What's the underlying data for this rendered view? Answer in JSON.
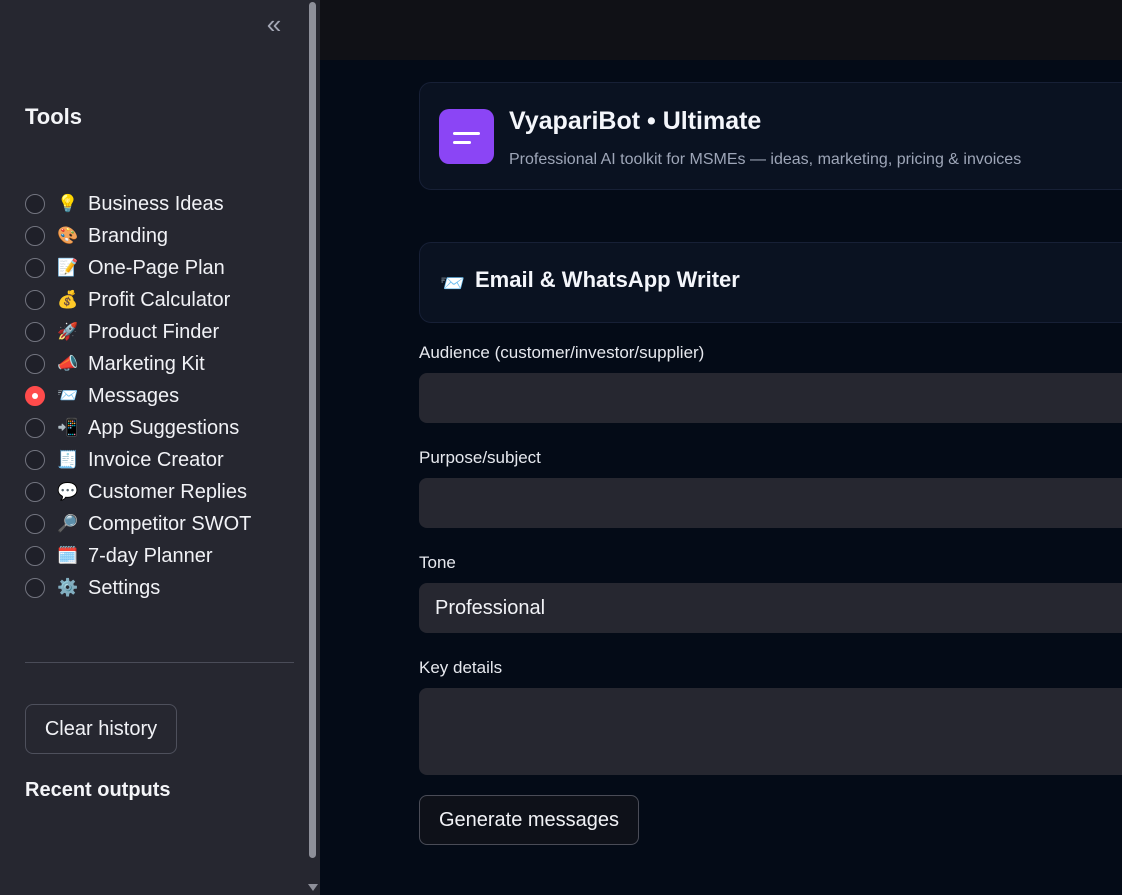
{
  "sidebar": {
    "title": "Tools",
    "items": [
      {
        "icon": "💡",
        "label": "Business Ideas",
        "selected": false
      },
      {
        "icon": "🎨",
        "label": "Branding",
        "selected": false
      },
      {
        "icon": "📝",
        "label": "One-Page Plan",
        "selected": false
      },
      {
        "icon": "💰",
        "label": "Profit Calculator",
        "selected": false
      },
      {
        "icon": "🚀",
        "label": "Product Finder",
        "selected": false
      },
      {
        "icon": "📣",
        "label": "Marketing Kit",
        "selected": false
      },
      {
        "icon": "📨",
        "label": "Messages",
        "selected": true
      },
      {
        "icon": "📲",
        "label": "App Suggestions",
        "selected": false
      },
      {
        "icon": "🧾",
        "label": "Invoice Creator",
        "selected": false
      },
      {
        "icon": "💬",
        "label": "Customer Replies",
        "selected": false
      },
      {
        "icon": "🔎",
        "label": "Competitor SWOT",
        "selected": false
      },
      {
        "icon": "🗓️",
        "label": "7-day Planner",
        "selected": false
      },
      {
        "icon": "⚙️",
        "label": "Settings",
        "selected": false
      }
    ],
    "clear_history_label": "Clear history",
    "recent_outputs_label": "Recent outputs",
    "collapse_icon": "«"
  },
  "header": {
    "title": "VyapariBot • Ultimate",
    "subtitle": "Professional AI toolkit for MSMEs — ideas, marketing, pricing & invoices"
  },
  "section": {
    "icon": "📨",
    "title": "Email & WhatsApp Writer"
  },
  "form": {
    "audience_label": "Audience (customer/investor/supplier)",
    "audience_value": "",
    "purpose_label": "Purpose/subject",
    "purpose_value": "",
    "tone_label": "Tone",
    "tone_value": "Professional",
    "details_label": "Key details",
    "details_value": "",
    "generate_label": "Generate messages"
  },
  "colors": {
    "accent": "#ff4b4b",
    "logo": "#8b45f5",
    "sidebar_bg": "#262730",
    "main_bg": "#040b17"
  }
}
